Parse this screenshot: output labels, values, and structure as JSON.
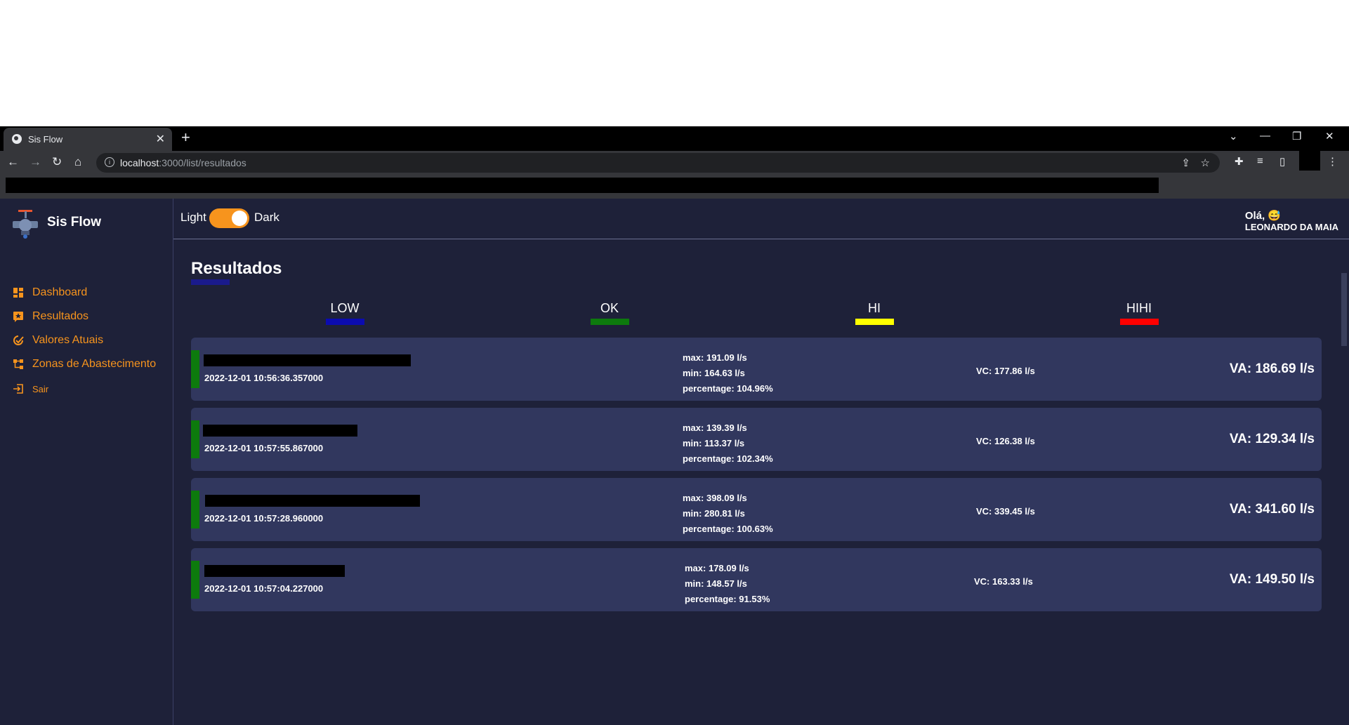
{
  "browser": {
    "tab_title": "Sis Flow",
    "tab_close": "✕",
    "new_tab": "+",
    "url_host": "localhost",
    "url_path": ":3000/list/resultados"
  },
  "app": {
    "brand": "Sis Flow",
    "menu": [
      {
        "label": "Dashboard",
        "icon": "dashboard-icon"
      },
      {
        "label": "Resultados",
        "icon": "results-icon"
      },
      {
        "label": "Valores Atuais",
        "icon": "current-values-icon"
      },
      {
        "label": "Zonas de Abastecimento",
        "icon": "supply-zones-icon"
      },
      {
        "label": "Sair",
        "icon": "logout-icon"
      }
    ],
    "theme": {
      "light_label": "Light",
      "dark_label": "Dark",
      "dark_enabled": true
    },
    "greeting": {
      "hello": "Olá, 😅",
      "user": "LEONARDO DA MAIA"
    },
    "colors": {
      "accent": "#f7941d",
      "background": "#1e2139",
      "card": "#31375e"
    }
  },
  "page": {
    "title": "Resultados",
    "legend": [
      {
        "label": "LOW",
        "color": "#0b0bb0"
      },
      {
        "label": "OK",
        "color": "#0d7a0d"
      },
      {
        "label": "HI",
        "color": "#ffff00"
      },
      {
        "label": "HIHI",
        "color": "#ff0000"
      }
    ],
    "results": [
      {
        "timestamp": "2022-12-01 10:56:36.357000",
        "max": "max: 191.09 l/s",
        "min": "min: 164.63 l/s",
        "percentage": "percentage: 104.96%",
        "vc": "VC: 177.86 l/s",
        "va": "VA: 186.69 l/s",
        "status": "OK",
        "status_color": "#0d7a0d"
      },
      {
        "timestamp": "2022-12-01 10:57:55.867000",
        "max": "max: 139.39 l/s",
        "min": "min: 113.37 l/s",
        "percentage": "percentage: 102.34%",
        "vc": "VC: 126.38 l/s",
        "va": "VA: 129.34 l/s",
        "status": "OK",
        "status_color": "#0d7a0d"
      },
      {
        "timestamp": "2022-12-01 10:57:28.960000",
        "max": "max: 398.09 l/s",
        "min": "min: 280.81 l/s",
        "percentage": "percentage: 100.63%",
        "vc": "VC: 339.45 l/s",
        "va": "VA: 341.60 l/s",
        "status": "OK",
        "status_color": "#0d7a0d"
      },
      {
        "timestamp": "2022-12-01 10:57:04.227000",
        "max": "max: 178.09 l/s",
        "min": "min: 148.57 l/s",
        "percentage": "percentage: 91.53%",
        "vc": "VC: 163.33 l/s",
        "va": "VA: 149.50 l/s",
        "status": "OK",
        "status_color": "#0d7a0d"
      }
    ]
  }
}
